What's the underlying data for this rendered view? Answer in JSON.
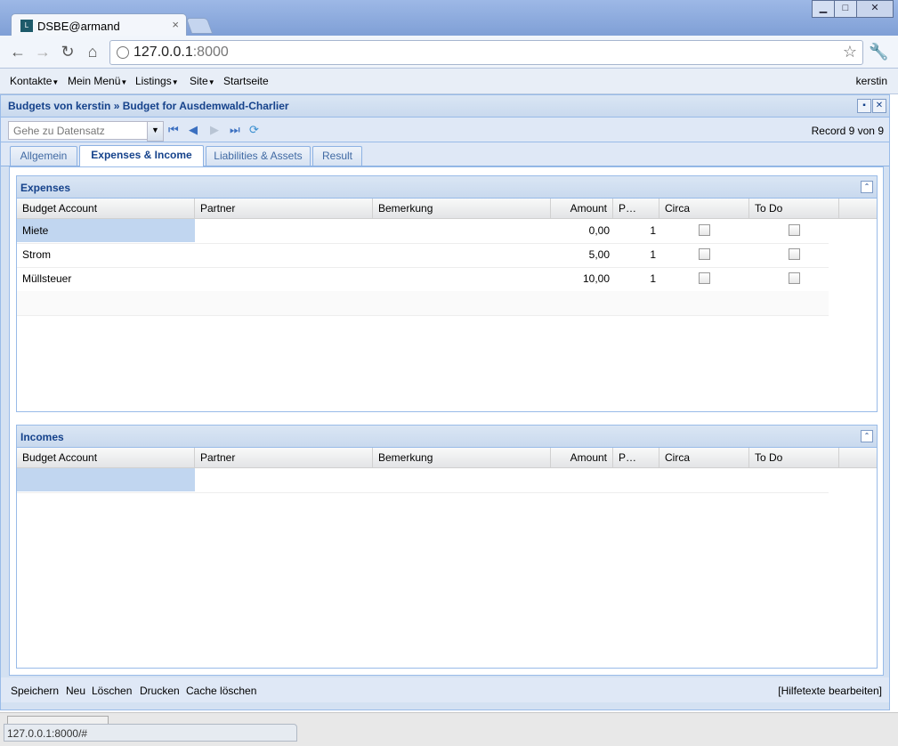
{
  "browser": {
    "tab_title": "DSBE@armand",
    "tab_close": "×",
    "url_host": "127.0.0.1",
    "url_port": ":8000",
    "status_url": "127.0.0.1:8000/#"
  },
  "menu": {
    "items": [
      {
        "label": "Kontakte",
        "has_dropdown": true
      },
      {
        "label": "Mein Menü",
        "has_dropdown": true
      },
      {
        "label": "Listings",
        "has_dropdown": true
      },
      {
        "label": "Site",
        "has_dropdown": true
      },
      {
        "label": "Startseite",
        "has_dropdown": false
      }
    ],
    "user": "kerstin"
  },
  "panel": {
    "title": "Budgets von kerstin » Budget for Ausdemwald-Charlier"
  },
  "navigation": {
    "goto_placeholder": "Gehe zu Datensatz",
    "record_text": "Record 9 von 9"
  },
  "tabs": [
    {
      "label": "Allgemein",
      "active": false
    },
    {
      "label": "Expenses & Income",
      "active": true
    },
    {
      "label": "Liabilities & Assets",
      "active": false
    },
    {
      "label": "Result",
      "active": false
    }
  ],
  "expenses": {
    "title": "Expenses",
    "columns": [
      "Budget Account",
      "Partner",
      "Bemerkung",
      "Amount",
      "P…",
      "Circa",
      "To Do"
    ],
    "rows": [
      {
        "account": "Miete",
        "partner": "",
        "bemerkung": "",
        "amount": "0,00",
        "p": "1",
        "circa": false,
        "todo": false
      },
      {
        "account": "Strom",
        "partner": "",
        "bemerkung": "",
        "amount": "5,00",
        "p": "1",
        "circa": false,
        "todo": false
      },
      {
        "account": "Müllsteuer",
        "partner": "",
        "bemerkung": "",
        "amount": "10,00",
        "p": "1",
        "circa": false,
        "todo": false
      }
    ]
  },
  "incomes": {
    "title": "Incomes",
    "columns": [
      "Budget Account",
      "Partner",
      "Bemerkung",
      "Amount",
      "P…",
      "Circa",
      "To Do"
    ]
  },
  "footer": {
    "actions": [
      "Speichern",
      "Neu",
      "Löschen",
      "Drucken",
      "Cache löschen"
    ],
    "help": "[Hilfetexte bearbeiten]"
  }
}
